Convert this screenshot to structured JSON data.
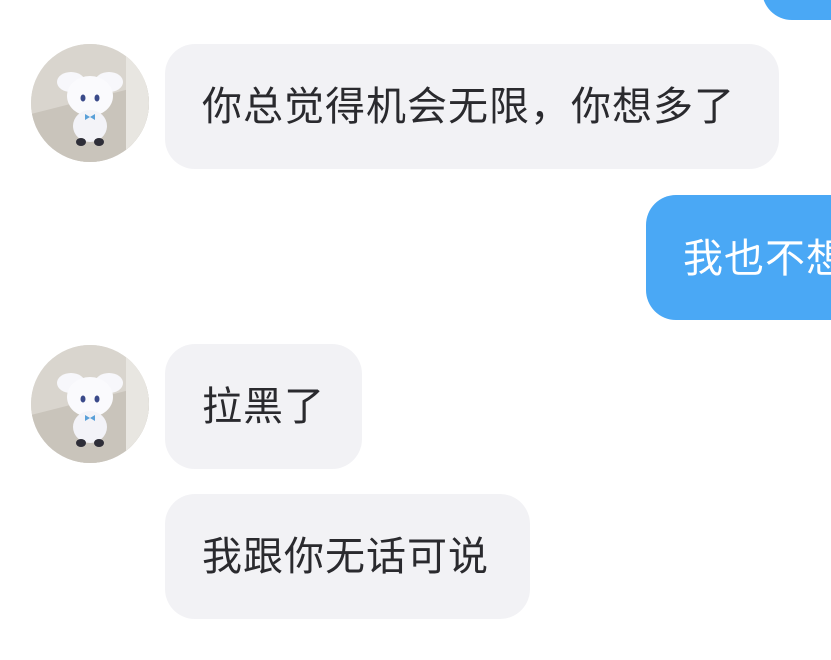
{
  "messages": [
    {
      "side": "outgoing",
      "text": ""
    },
    {
      "side": "incoming",
      "text": "你总觉得机会无限，你想多了"
    },
    {
      "side": "outgoing",
      "text": "我也不想"
    },
    {
      "side": "incoming",
      "text": "拉黑了"
    },
    {
      "side": "incoming",
      "text": "我跟你无话可说"
    }
  ],
  "colors": {
    "incoming_bubble": "#f2f2f5",
    "outgoing_bubble": "#4aa8f5",
    "incoming_text": "#2a2a2e",
    "outgoing_text": "#ffffff"
  },
  "avatar": {
    "icon": "plush-toy-avatar-icon"
  }
}
